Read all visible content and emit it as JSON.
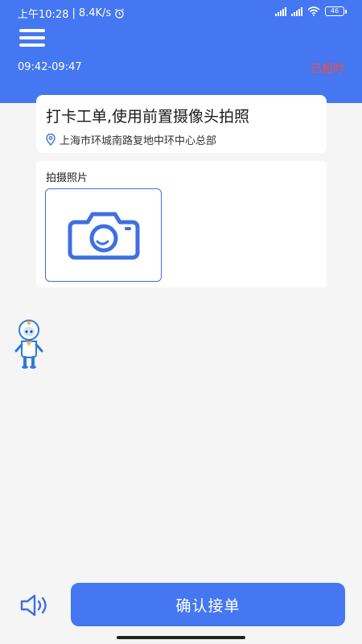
{
  "status_bar": {
    "time": "上午10:28",
    "net_speed": "8.4K/s",
    "battery": "46",
    "icons": [
      "alarm-icon",
      "signal-icon",
      "wifi-icon",
      "battery-icon"
    ]
  },
  "header": {
    "time_range": "09:42-09:47",
    "status": "已超时"
  },
  "task": {
    "title": "打卡工单,使用前置摄像头拍照",
    "location": "上海市环城南路复地中环中心总部"
  },
  "photo": {
    "label": "拍摄照片"
  },
  "footer": {
    "confirm_label": "确认接单"
  },
  "colors": {
    "primary": "#4477f1",
    "overtime": "#ff4a3d",
    "background": "#f5f5f5"
  }
}
